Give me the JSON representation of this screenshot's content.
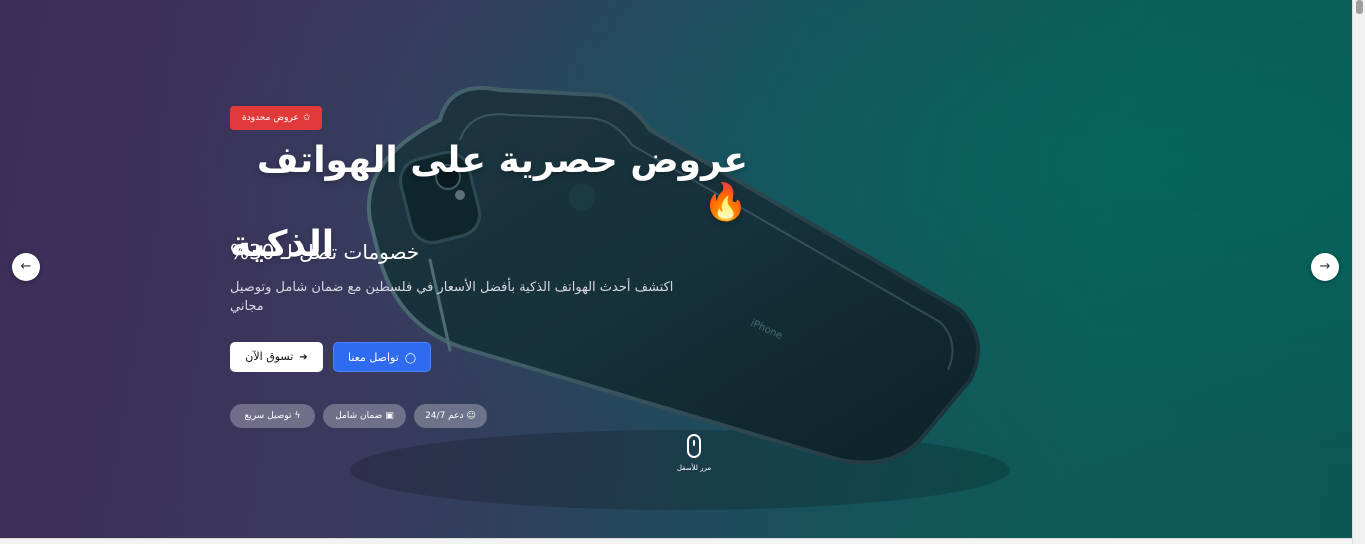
{
  "hero": {
    "badge": {
      "label": "عروض محدودة",
      "icon": "star-icon"
    },
    "headline_line1": "عروض حصرية على الهواتف",
    "headline_emoji": "🔥",
    "headline_line2": "الذكية",
    "subheadline": "%خصومات تصل لـ 30",
    "description": "اكتشف أحدث الهواتف الذكية بأفضل الأسعار في فلسطين مع ضمان شامل وتوصيل مجاني",
    "buttons": {
      "shop": {
        "label": "تسوق الآن",
        "icon": "arrow-right-icon"
      },
      "contact": {
        "label": "تواصل معنا",
        "icon": "chat-icon"
      }
    },
    "features": [
      {
        "label": "توصيل سريع",
        "icon": "bolt-icon"
      },
      {
        "label": "ضمان شامل",
        "icon": "gift-icon"
      },
      {
        "label": "دعم 24/7",
        "icon": "users-icon"
      }
    ],
    "scroll_hint": "مرر للأسفل"
  },
  "carousel": {
    "prev_icon": "arrow-left-icon",
    "next_icon": "arrow-right-icon"
  },
  "colors": {
    "badge": "#e23a3a",
    "primary": "#2f6bf0",
    "hero_left": "#3d2f57",
    "hero_right": "#0b5753"
  }
}
